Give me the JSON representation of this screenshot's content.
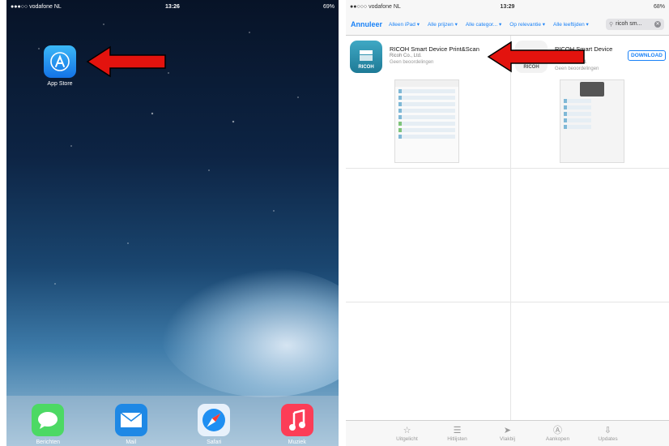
{
  "left": {
    "status": {
      "carrier": "●●●○○ vodafone NL",
      "time": "13:26",
      "battery": "69%"
    },
    "app_store_label": "App Store",
    "dock": [
      {
        "label": "Berichten",
        "icon": "messages-icon",
        "color": "#4cd964"
      },
      {
        "label": "Mail",
        "icon": "mail-icon",
        "color": "#1e88e5"
      },
      {
        "label": "Safari",
        "icon": "safari-icon",
        "color": "#e8f1fb"
      },
      {
        "label": "Muziek",
        "icon": "music-icon",
        "color": "#fc3d57"
      }
    ]
  },
  "right": {
    "status": {
      "carrier": "●●○○○ vodafone NL",
      "time": "13:29",
      "battery": "68%"
    },
    "nav": {
      "cancel": "Annuleer",
      "filters": [
        "Alleen iPad ▾",
        "Alle prijzen ▾",
        "Alle categor... ▾",
        "Op relevantie ▾",
        "Alle leeftijden ▾"
      ],
      "search_value": "ricoh sm..."
    },
    "results": [
      {
        "title": "RICOH Smart Device Print&Scan",
        "developer": "Ricoh Co., Ltd.",
        "rating": "Geen beoordelingen",
        "icon_text": "RICOH"
      },
      {
        "title": "RICOH Smart Device Connector",
        "developer": "Ricoh Co., Ltd.",
        "rating": "Geen beoordelingen",
        "icon_text": "RICOH",
        "button": "DOWNLOAD"
      }
    ],
    "tabs": [
      {
        "label": "Uitgelicht",
        "glyph": "☆"
      },
      {
        "label": "Hitlijsten",
        "glyph": "☰"
      },
      {
        "label": "Vlakbij",
        "glyph": "➤"
      },
      {
        "label": "Aankopen",
        "glyph": "Ⓐ"
      },
      {
        "label": "Updates",
        "glyph": "⇩"
      }
    ]
  },
  "colors": {
    "accent": "#1a82f7",
    "arrow": "#e3130e"
  }
}
